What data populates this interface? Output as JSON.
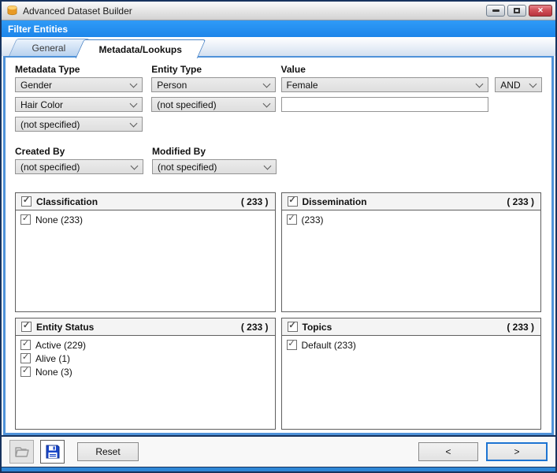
{
  "window": {
    "title": "Advanced Dataset Builder"
  },
  "header": {
    "title": "Filter Entities"
  },
  "tabs": [
    {
      "label": "General",
      "active": false
    },
    {
      "label": "Metadata/Lookups",
      "active": true
    }
  ],
  "filters": {
    "metadata_type": {
      "label": "Metadata Type",
      "values": [
        "Gender",
        "Hair Color",
        "(not specified)"
      ]
    },
    "entity_type": {
      "label": "Entity Type",
      "values": [
        "Person",
        "(not specified)"
      ]
    },
    "value": {
      "label": "Value",
      "selected": "Female",
      "input_value": ""
    },
    "operator": {
      "value": "AND"
    },
    "created_by": {
      "label": "Created By",
      "value": "(not specified)"
    },
    "modified_by": {
      "label": "Modified By",
      "value": "(not specified)"
    }
  },
  "groups": [
    {
      "title": "Classification",
      "count": "( 233 )",
      "checked": true,
      "items": [
        {
          "label": "None (233)",
          "checked": true
        }
      ]
    },
    {
      "title": "Dissemination",
      "count": "( 233 )",
      "checked": true,
      "items": [
        {
          "label": "(233)",
          "checked": true
        }
      ]
    },
    {
      "title": "Entity Status",
      "count": "( 233 )",
      "checked": true,
      "items": [
        {
          "label": "Active (229)",
          "checked": true
        },
        {
          "label": "Alive (1)",
          "checked": true
        },
        {
          "label": "None (3)",
          "checked": true
        }
      ]
    },
    {
      "title": "Topics",
      "count": "( 233 )",
      "checked": true,
      "items": [
        {
          "label": "Default (233)",
          "checked": true
        }
      ]
    }
  ],
  "footer": {
    "reset_label": "Reset",
    "prev_label": "<",
    "next_label": ">"
  },
  "colors": {
    "accent_blue": "#1d86ea",
    "panel_border": "#4f92d9",
    "close_red": "#b93540",
    "save_icon_blue": "#1846c8"
  }
}
